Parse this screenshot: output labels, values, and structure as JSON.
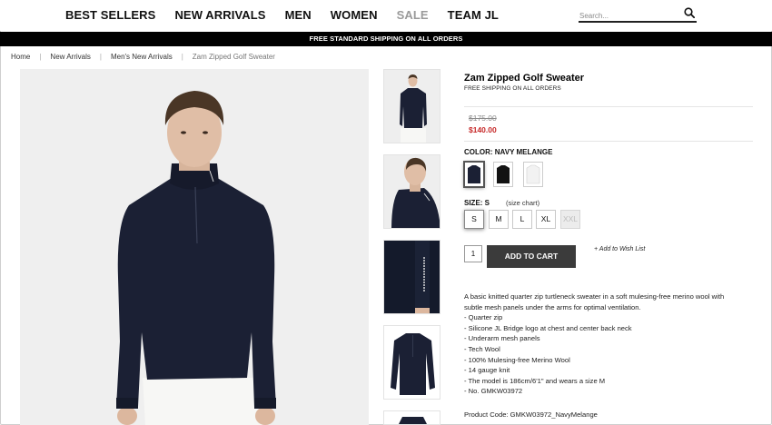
{
  "nav": {
    "items": [
      "BEST SELLERS",
      "NEW ARRIVALS",
      "MEN",
      "WOMEN",
      "SALE",
      "TEAM JL"
    ]
  },
  "search": {
    "placeholder": "Search...",
    "icon": "search-icon"
  },
  "shipping_bar": "FREE STANDARD SHIPPING ON ALL ORDERS",
  "breadcrumb": [
    "Home",
    "New Arrivals",
    "Men's New Arrivals",
    "Zam Zipped Golf Sweater"
  ],
  "product": {
    "title": "Zam Zipped Golf Sweater",
    "shipping_note": "FREE SHIPPING ON ALL ORDERS",
    "price_original": "$175.00",
    "price_sale": "$140.00",
    "color_label": "COLOR: NAVY MELANGE",
    "colors": [
      {
        "name": "navy",
        "hex": "#1b2034",
        "selected": true
      },
      {
        "name": "black",
        "hex": "#121212",
        "selected": false
      },
      {
        "name": "white",
        "hex": "#f2f2f2",
        "selected": false
      }
    ],
    "size_label": "SIZE: S",
    "size_chart": "(size chart)",
    "sizes": [
      {
        "label": "S",
        "state": "selected"
      },
      {
        "label": "M",
        "state": "available"
      },
      {
        "label": "L",
        "state": "available"
      },
      {
        "label": "XL",
        "state": "available"
      },
      {
        "label": "XXL",
        "state": "disabled"
      }
    ],
    "quantity": "1",
    "add_to_cart": "ADD TO CART",
    "wish_list": "+ Add to Wish List",
    "description": [
      "A basic knitted quarter zip turtleneck sweater in a soft mulesing-free merino wool with",
      "subtle mesh panels under the arms for optimal ventilation.",
      "- Quarter zip",
      "- Silicone JL Bridge logo at chest and center back neck",
      "- Underarm mesh panels",
      "- Tech Wool",
      "- 100% Mulesing-free Merino Wool",
      "- 14 gauge knit",
      "- The model is 186cm/6'1\" and wears a size M",
      "- No. GMKW03972"
    ],
    "product_code": "Product Code: GMKW03972_NavyMelange"
  },
  "colors": {
    "sweater_navy": "#1b2034",
    "sale_red": "#c62828",
    "button_dark": "#3b3b3b",
    "image_bg": "#efefef"
  }
}
